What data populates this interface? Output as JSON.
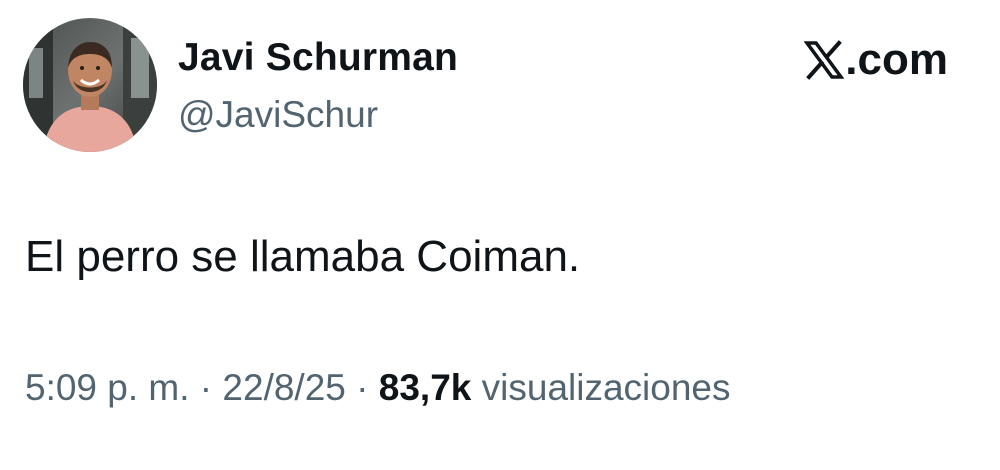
{
  "author": {
    "display_name": "Javi Schurman",
    "handle": "@JaviSchur"
  },
  "brand": {
    "name": "X.com",
    "suffix": ".com",
    "icon": "x-logo-icon"
  },
  "tweet": {
    "text": "El perro se llamaba Coiman."
  },
  "meta": {
    "time": "5:09 p. m.",
    "separator": " · ",
    "date": "22/8/25",
    "views_count": "83,7k",
    "views_label": "visualizaciones"
  },
  "colors": {
    "text_primary": "#0f1419",
    "text_secondary": "#536471",
    "background": "#ffffff"
  }
}
